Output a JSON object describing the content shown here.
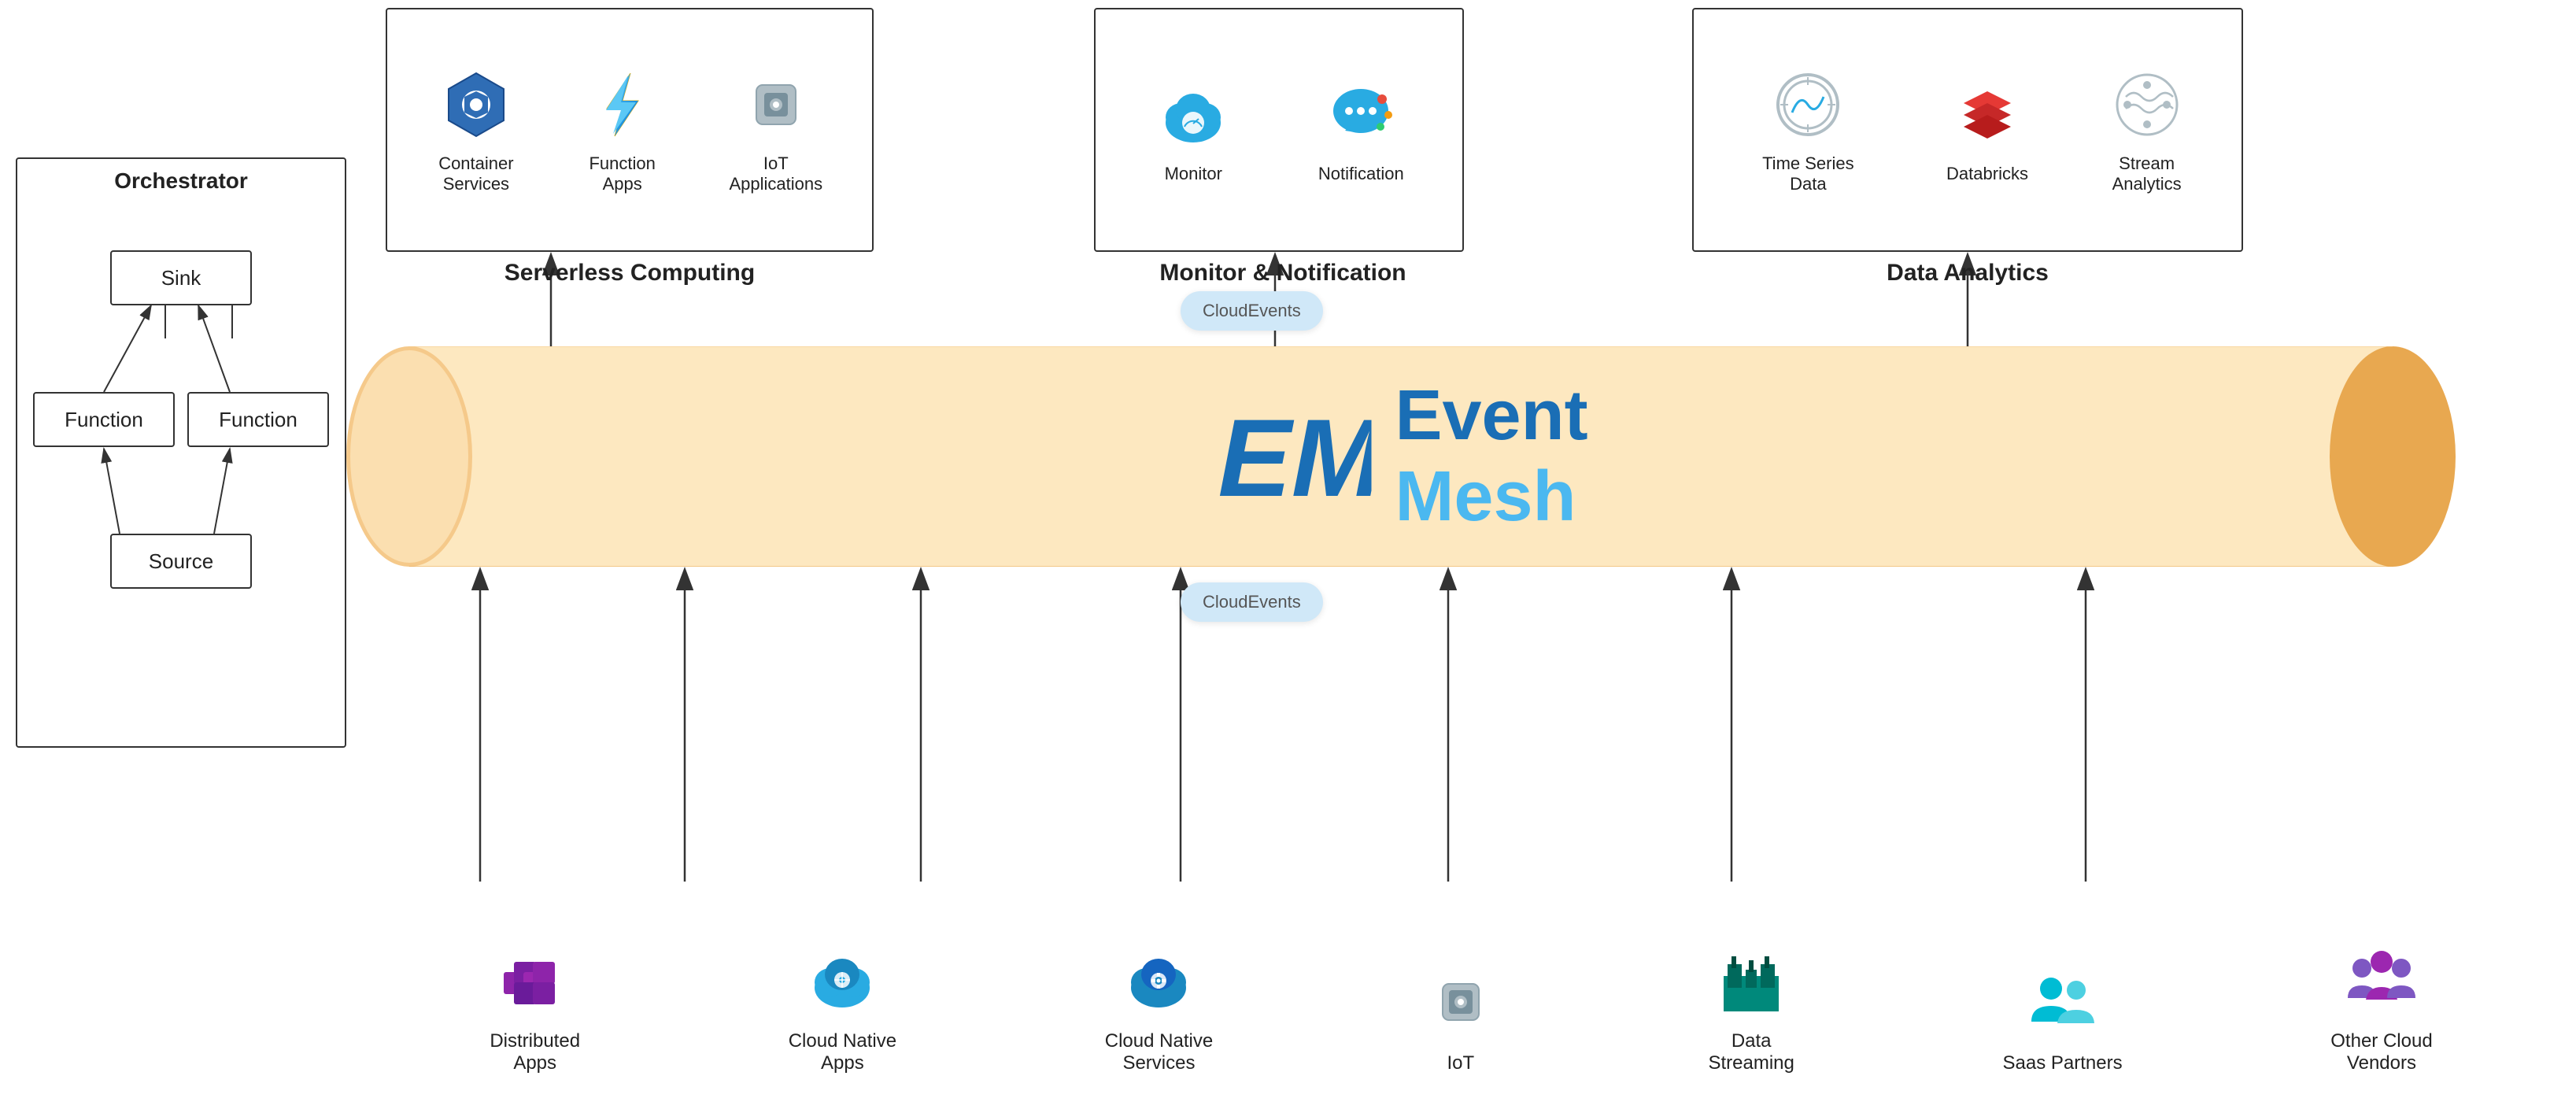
{
  "orchestrator": {
    "title": "Orchestrator",
    "nodes": {
      "sink": "Sink",
      "func1": "Function",
      "func2": "Function",
      "source": "Source"
    }
  },
  "sections": {
    "serverless": {
      "label": "Serverless Computing",
      "items": [
        {
          "id": "container-services",
          "label": "Container\nServices"
        },
        {
          "id": "function-apps",
          "label": "Function\nApps"
        },
        {
          "id": "iot-applications",
          "label": "IoT\nApplications"
        }
      ]
    },
    "monitor": {
      "label": "Monitor & Notification",
      "items": [
        {
          "id": "monitor",
          "label": "Monitor"
        },
        {
          "id": "notification",
          "label": "Notification"
        }
      ]
    },
    "analytics": {
      "label": "Data Analytics",
      "items": [
        {
          "id": "time-series",
          "label": "Time Series Data"
        },
        {
          "id": "databricks",
          "label": "Databricks"
        },
        {
          "id": "stream-analytics",
          "label": "Stream\nAnalytics"
        }
      ]
    }
  },
  "eventmesh": {
    "event_text": "Event",
    "mesh_text": "Mesh"
  },
  "cloud_events": {
    "label": "CloudEvents"
  },
  "bottom_items": [
    {
      "id": "distributed-apps",
      "label": "Distributed\nApps"
    },
    {
      "id": "cloud-native-apps",
      "label": "Cloud Native\nApps"
    },
    {
      "id": "cloud-native-services",
      "label": "Cloud Native\nServices"
    },
    {
      "id": "iot",
      "label": "IoT"
    },
    {
      "id": "data-streaming",
      "label": "Data\nStreaming"
    },
    {
      "id": "saas-partners",
      "label": "Saas Partners"
    },
    {
      "id": "other-cloud-vendors",
      "label": "Other Cloud\nVendors"
    }
  ]
}
